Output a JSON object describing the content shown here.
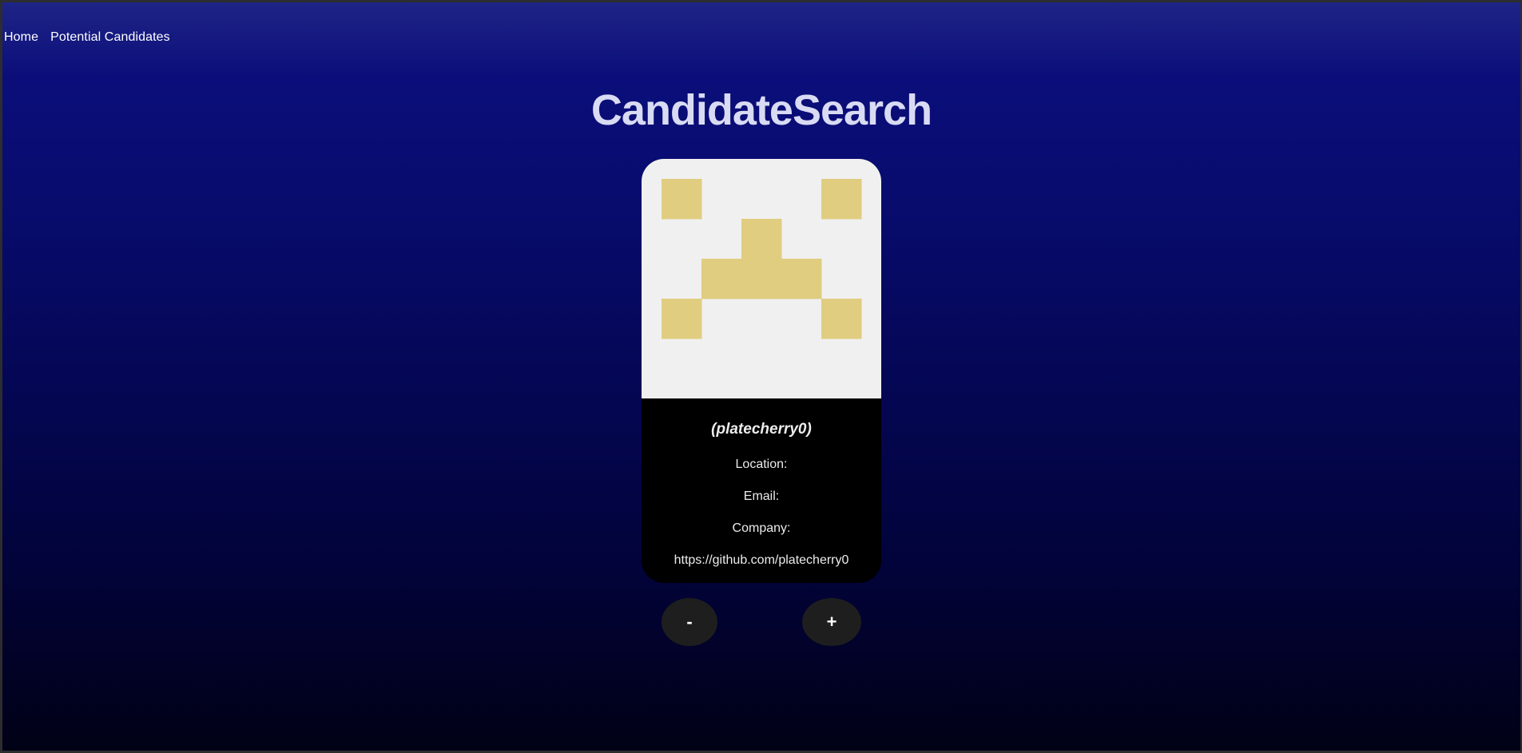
{
  "nav": {
    "home": "Home",
    "potential": "Potential Candidates"
  },
  "page": {
    "title": "CandidateSearch"
  },
  "candidate": {
    "username": "(platecherry0)",
    "location_label": "Location:",
    "email_label": "Email:",
    "company_label": "Company:",
    "profile_url": "https://github.com/platecherry0",
    "avatar_icon": "identicon",
    "avatar_colors": {
      "background": "#f0f0f0",
      "pattern": "#e0cd80"
    }
  },
  "actions": {
    "reject_label": "-",
    "accept_label": "+"
  }
}
